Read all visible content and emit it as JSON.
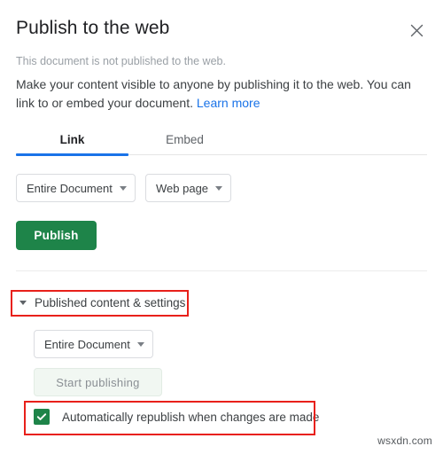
{
  "dialog": {
    "title": "Publish to the web",
    "close_icon": "close-icon",
    "subtitle": "This document is not published to the web.",
    "description_text": "Make your content visible to anyone by publishing it to the web. You can link to or embed your document. ",
    "learn_more_label": "Learn more"
  },
  "tabs": [
    {
      "label": "Link",
      "active": true
    },
    {
      "label": "Embed",
      "active": false
    }
  ],
  "link_panel": {
    "scope_select": {
      "value": "Entire Document",
      "caret_icon": "chevron-down-icon"
    },
    "format_select": {
      "value": "Web page",
      "caret_icon": "chevron-down-icon"
    },
    "publish_label": "Publish"
  },
  "published_settings": {
    "toggle_label": "Published content & settings",
    "toggle_icon": "triangle-down-icon",
    "scope_select": {
      "value": "Entire Document",
      "caret_icon": "chevron-down-icon"
    },
    "start_publishing_label": "Start publishing",
    "auto_republish": {
      "label": "Automatically republish when changes are made",
      "checked": true,
      "check_icon": "check-icon"
    }
  },
  "colors": {
    "publish_green": "#1e8449",
    "tab_accent_blue": "#1a73e8",
    "link_blue": "#1a73e8",
    "annotation_red": "#e8201a",
    "text_primary": "#202124",
    "text_secondary": "#3c4043",
    "text_muted": "#9aa0a6"
  },
  "watermark": {
    "text": "wsxdn.com"
  }
}
